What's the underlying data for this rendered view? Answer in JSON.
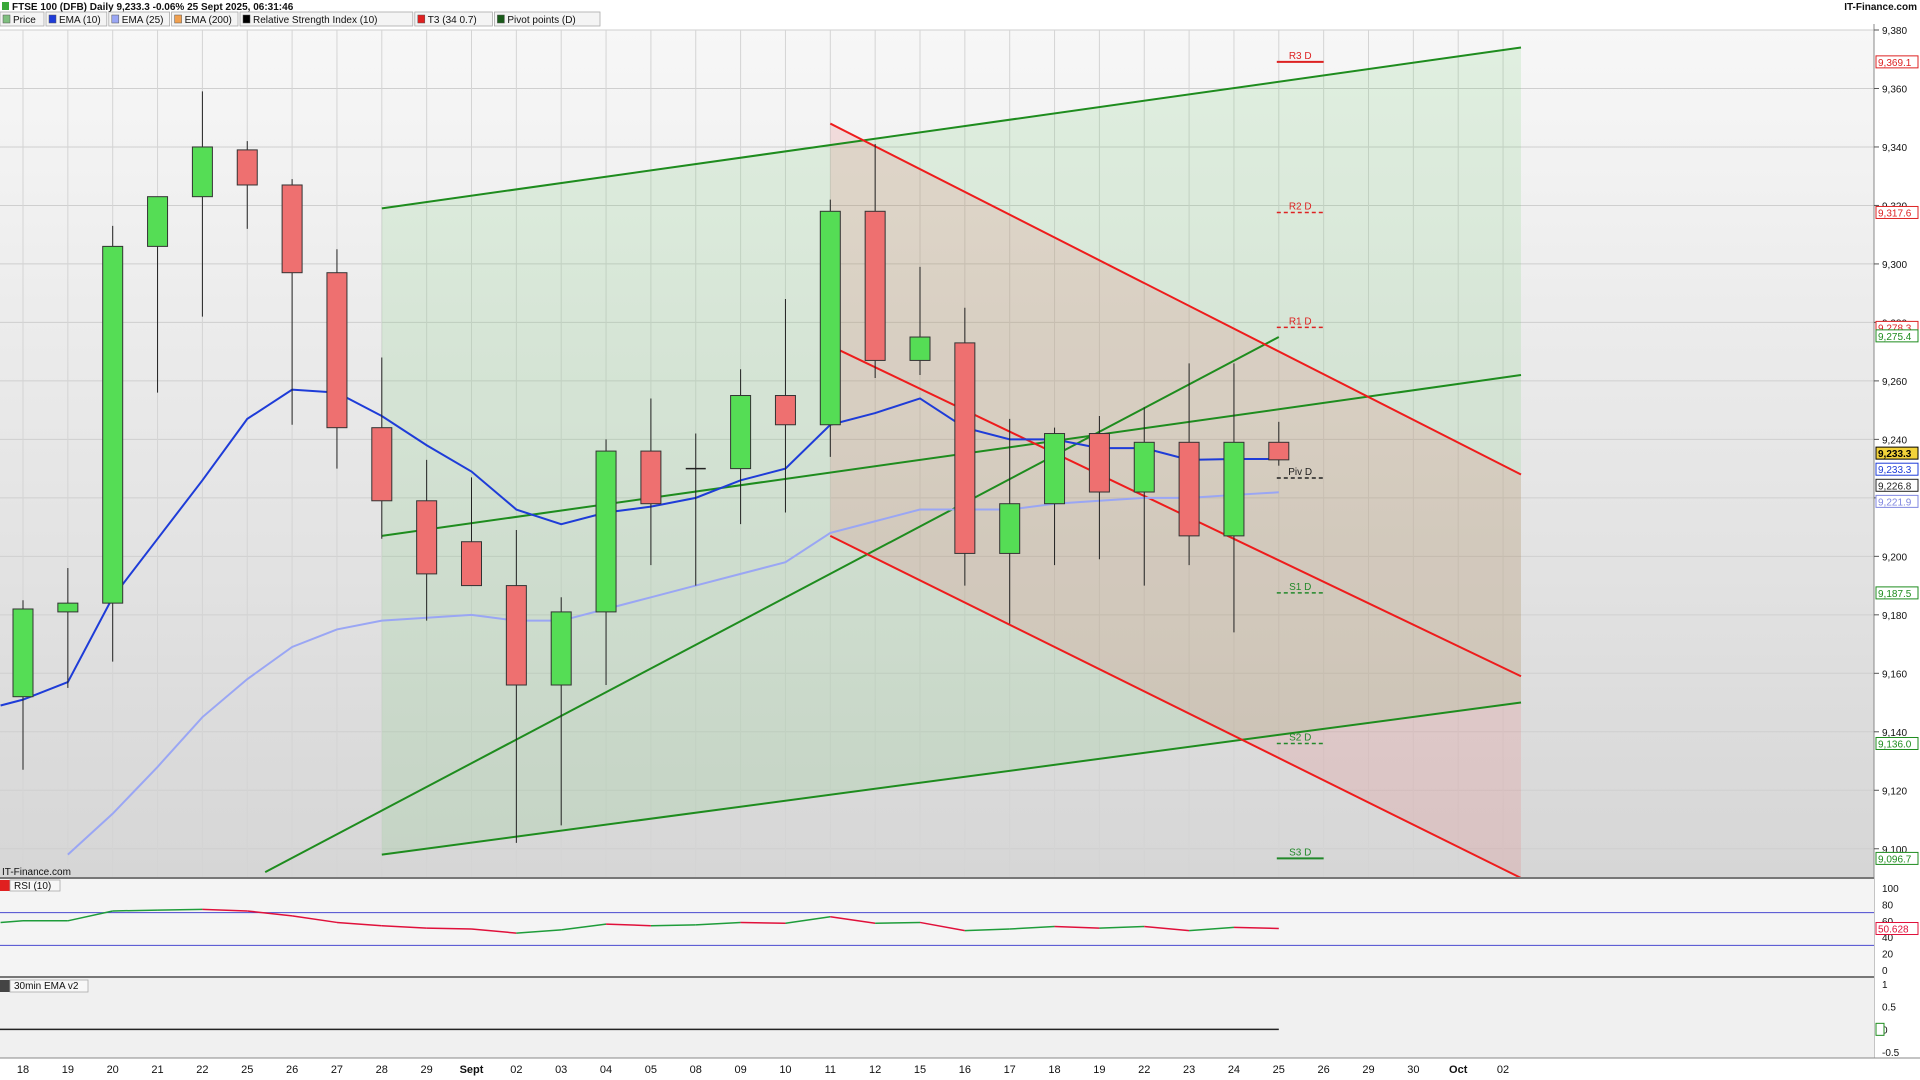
{
  "header": {
    "title": "FTSE 100 (DFB) Daily 9,233.3 -0.06% 25 Sept 2025, 06:31:46",
    "brand": "IT-Finance.com"
  },
  "legend": [
    {
      "label": "Price",
      "color": "#7fbf7f"
    },
    {
      "label": "EMA (10)",
      "color": "#1e3cd8"
    },
    {
      "label": "EMA (25)",
      "color": "#9aa6f4"
    },
    {
      "label": "EMA (200)",
      "color": "#f0a050"
    },
    {
      "label": "Relative Strength Index (10)",
      "color": "#000000"
    },
    {
      "label": "T3 (34 0.7)",
      "color": "#e02020"
    },
    {
      "label": "Pivot points (D)",
      "color": "#1a5a1a"
    }
  ],
  "watermark": "IT-Finance.com",
  "colors": {
    "up": "#55dd55",
    "down": "#ee7070",
    "ema10": "#1e3cd8",
    "ema25": "#9aa6f4",
    "green_channel": "#1e8c1e",
    "red_channel": "#ee1c1c",
    "rsi": "#e0103a"
  },
  "chart_data": {
    "type": "candlestick",
    "y_range": [
      9090,
      9380
    ],
    "y_ticks": [
      {
        "v": 9380,
        "label": "9,380"
      },
      {
        "v": 9360,
        "label": "9,360"
      },
      {
        "v": 9340,
        "label": "9,340"
      },
      {
        "v": 9320,
        "label": "9,320"
      },
      {
        "v": 9300,
        "label": "9,300"
      },
      {
        "v": 9280,
        "label": "9,280"
      },
      {
        "v": 9260,
        "label": "9,260"
      },
      {
        "v": 9240,
        "label": "9,240"
      },
      {
        "v": 9220,
        "label": "9,220"
      },
      {
        "v": 9200,
        "label": "9,200"
      },
      {
        "v": 9180,
        "label": "9,180"
      },
      {
        "v": 9160,
        "label": "9,160"
      },
      {
        "v": 9140,
        "label": "9,140"
      },
      {
        "v": 9120,
        "label": "9,120"
      },
      {
        "v": 9100,
        "label": "9,100"
      }
    ],
    "x_labels": [
      {
        "i": 0,
        "label": "18"
      },
      {
        "i": 1,
        "label": "19"
      },
      {
        "i": 2,
        "label": "20"
      },
      {
        "i": 3,
        "label": "21"
      },
      {
        "i": 4,
        "label": "22"
      },
      {
        "i": 5,
        "label": "25"
      },
      {
        "i": 6,
        "label": "26"
      },
      {
        "i": 7,
        "label": "27"
      },
      {
        "i": 8,
        "label": "28"
      },
      {
        "i": 9,
        "label": "29"
      },
      {
        "i": 10,
        "label": "Sept"
      },
      {
        "i": 11,
        "label": "02"
      },
      {
        "i": 12,
        "label": "03"
      },
      {
        "i": 13,
        "label": "04"
      },
      {
        "i": 14,
        "label": "05"
      },
      {
        "i": 15,
        "label": "08"
      },
      {
        "i": 16,
        "label": "09"
      },
      {
        "i": 17,
        "label": "10"
      },
      {
        "i": 18,
        "label": "11"
      },
      {
        "i": 19,
        "label": "12"
      },
      {
        "i": 20,
        "label": "15"
      },
      {
        "i": 21,
        "label": "16"
      },
      {
        "i": 22,
        "label": "17"
      },
      {
        "i": 23,
        "label": "18"
      },
      {
        "i": 24,
        "label": "19"
      },
      {
        "i": 25,
        "label": "22"
      },
      {
        "i": 26,
        "label": "23"
      },
      {
        "i": 27,
        "label": "24"
      },
      {
        "i": 28,
        "label": "25"
      },
      {
        "i": 29,
        "label": "26"
      },
      {
        "i": 30,
        "label": "29"
      },
      {
        "i": 31,
        "label": "30"
      },
      {
        "i": 32,
        "label": "Oct"
      },
      {
        "i": 33,
        "label": "02"
      }
    ],
    "candles": [
      {
        "i": 0,
        "o": 9152,
        "h": 9185,
        "l": 9127,
        "c": 9182
      },
      {
        "i": 1,
        "o": 9181,
        "h": 9196,
        "l": 9155,
        "c": 9184
      },
      {
        "i": 2,
        "o": 9184,
        "h": 9313,
        "l": 9164,
        "c": 9306
      },
      {
        "i": 3,
        "o": 9306,
        "h": 9320,
        "l": 9256,
        "c": 9323
      },
      {
        "i": 4,
        "o": 9323,
        "h": 9359,
        "l": 9282,
        "c": 9340
      },
      {
        "i": 5,
        "o": 9339,
        "h": 9342,
        "l": 9312,
        "c": 9327
      },
      {
        "i": 6,
        "o": 9327,
        "h": 9329,
        "l": 9245,
        "c": 9297
      },
      {
        "i": 7,
        "o": 9297,
        "h": 9305,
        "l": 9230,
        "c": 9244
      },
      {
        "i": 8,
        "o": 9244,
        "h": 9268,
        "l": 9206,
        "c": 9219
      },
      {
        "i": 9,
        "o": 9219,
        "h": 9233,
        "l": 9178,
        "c": 9194
      },
      {
        "i": 10,
        "o": 9205,
        "h": 9227,
        "l": 9190,
        "c": 9190
      },
      {
        "i": 11,
        "o": 9190,
        "h": 9209,
        "l": 9102,
        "c": 9156
      },
      {
        "i": 12,
        "o": 9156,
        "h": 9186,
        "l": 9108,
        "c": 9181
      },
      {
        "i": 13,
        "o": 9181,
        "h": 9240,
        "l": 9156,
        "c": 9236
      },
      {
        "i": 14,
        "o": 9236,
        "h": 9254,
        "l": 9197,
        "c": 9218
      },
      {
        "i": 15,
        "o": 9230,
        "h": 9242,
        "l": 9190,
        "c": 9230
      },
      {
        "i": 16,
        "o": 9230,
        "h": 9264,
        "l": 9211,
        "c": 9255
      },
      {
        "i": 17,
        "o": 9255,
        "h": 9288,
        "l": 9215,
        "c": 9245
      },
      {
        "i": 18,
        "o": 9245,
        "h": 9322,
        "l": 9234,
        "c": 9318
      },
      {
        "i": 19,
        "o": 9318,
        "h": 9341,
        "l": 9261,
        "c": 9267
      },
      {
        "i": 20,
        "o": 9267,
        "h": 9299,
        "l": 9262,
        "c": 9275
      },
      {
        "i": 21,
        "o": 9273,
        "h": 9285,
        "l": 9190,
        "c": 9201
      },
      {
        "i": 22,
        "o": 9201,
        "h": 9247,
        "l": 9177,
        "c": 9218
      },
      {
        "i": 23,
        "o": 9218,
        "h": 9244,
        "l": 9197,
        "c": 9242
      },
      {
        "i": 24,
        "o": 9242,
        "h": 9248,
        "l": 9199,
        "c": 9222
      },
      {
        "i": 25,
        "o": 9222,
        "h": 9251,
        "l": 9190,
        "c": 9239
      },
      {
        "i": 26,
        "o": 9239,
        "h": 9266,
        "l": 9197,
        "c": 9207
      },
      {
        "i": 27,
        "o": 9207,
        "h": 9266,
        "l": 9174,
        "c": 9239
      },
      {
        "i": 28,
        "o": 9239,
        "h": 9246,
        "l": 9231,
        "c": 9233
      }
    ],
    "ema10": [
      [
        -0.5,
        9149
      ],
      [
        0,
        9151
      ],
      [
        1,
        9157
      ],
      [
        2,
        9186
      ],
      [
        3,
        9206
      ],
      [
        4,
        9226
      ],
      [
        5,
        9247
      ],
      [
        6,
        9257
      ],
      [
        7,
        9256
      ],
      [
        8,
        9248
      ],
      [
        9,
        9238
      ],
      [
        10,
        9229
      ],
      [
        11,
        9216
      ],
      [
        12,
        9211
      ],
      [
        13,
        9215
      ],
      [
        14,
        9217
      ],
      [
        15,
        9220
      ],
      [
        16,
        9226
      ],
      [
        17,
        9230
      ],
      [
        18,
        9245
      ],
      [
        19,
        9249
      ],
      [
        20,
        9254
      ],
      [
        21,
        9244
      ],
      [
        22,
        9240
      ],
      [
        23,
        9240
      ],
      [
        24,
        9237
      ],
      [
        25,
        9237
      ],
      [
        26,
        9233
      ],
      [
        27,
        9233.3
      ],
      [
        28,
        9233.3
      ]
    ],
    "ema25": [
      [
        1,
        9098
      ],
      [
        2,
        9112
      ],
      [
        3,
        9128
      ],
      [
        4,
        9145
      ],
      [
        5,
        9158
      ],
      [
        6,
        9169
      ],
      [
        7,
        9175
      ],
      [
        8,
        9178
      ],
      [
        9,
        9179
      ],
      [
        10,
        9180
      ],
      [
        11,
        9178
      ],
      [
        12,
        9178
      ],
      [
        13,
        9182
      ],
      [
        14,
        9186
      ],
      [
        15,
        9190
      ],
      [
        16,
        9194
      ],
      [
        17,
        9198
      ],
      [
        18,
        9208
      ],
      [
        19,
        9212
      ],
      [
        20,
        9216
      ],
      [
        21,
        9216
      ],
      [
        22,
        9216
      ],
      [
        23,
        9218
      ],
      [
        24,
        9219
      ],
      [
        25,
        9220
      ],
      [
        26,
        9220
      ],
      [
        27,
        9221
      ],
      [
        28,
        9221.9
      ]
    ],
    "green_channel": [
      {
        "from": [
          8,
          9319
        ],
        "to": [
          33.4,
          9374
        ]
      },
      {
        "from": [
          8,
          9098
        ],
        "to": [
          33.4,
          9150
        ]
      },
      {
        "from": [
          8,
          9207
        ],
        "to": [
          33.4,
          9262
        ]
      },
      {
        "from": [
          5.4,
          9092
        ],
        "to": [
          28,
          9275
        ]
      }
    ],
    "red_channel": [
      {
        "from": [
          18,
          9348
        ],
        "to": [
          33.4,
          9228
        ]
      },
      {
        "from": [
          18,
          9272
        ],
        "to": [
          33.4,
          9159
        ]
      },
      {
        "from": [
          18,
          9207
        ],
        "to": [
          33.4,
          9090
        ]
      }
    ],
    "pivots": [
      {
        "label": "R3 D",
        "value": 9369.1,
        "color": "#dd2222",
        "dashed": false
      },
      {
        "label": "R2 D",
        "value": 9317.6,
        "color": "#dd2222",
        "dashed": true
      },
      {
        "label": "R1 D",
        "value": 9278.3,
        "color": "#dd2222",
        "dashed": true
      },
      {
        "label": "Piv D",
        "value": 9226.8,
        "color": "#222222",
        "dashed": true
      },
      {
        "label": "S1 D",
        "value": 9187.5,
        "color": "#22882a",
        "dashed": true
      },
      {
        "label": "S2 D",
        "value": 9136.0,
        "color": "#22882a",
        "dashed": true
      },
      {
        "label": "S3 D",
        "value": 9096.7,
        "color": "#22882a",
        "dashed": false
      }
    ],
    "price_tags": [
      {
        "label": "9,369.1",
        "value": 9369.1,
        "color": "#dd2222",
        "fill": "#ffffff"
      },
      {
        "label": "9,317.6",
        "value": 9317.6,
        "color": "#dd2222",
        "fill": "#ffffff"
      },
      {
        "label": "9,278.3",
        "value": 9278.3,
        "color": "#dd2222",
        "fill": "#ffffff"
      },
      {
        "label": "9,275.4",
        "value": 9275.4,
        "color": "#1e8c1e",
        "fill": "#ffffff"
      },
      {
        "label": "9,233.3",
        "value": 9235.3,
        "color": "#000000",
        "fill": "#f2d23a"
      },
      {
        "label": "9,233.3",
        "value": 9229.8,
        "color": "#1e3cd8",
        "fill": "#ffffff"
      },
      {
        "label": "9,226.8",
        "value": 9224.3,
        "color": "#222222",
        "fill": "#ffffff"
      },
      {
        "label": "9,221.9",
        "value": 9218.8,
        "color": "#7f86e0",
        "fill": "#ffffff"
      },
      {
        "label": "9,187.5",
        "value": 9187.5,
        "color": "#1e8c1e",
        "fill": "#ffffff"
      },
      {
        "label": "9,136.0",
        "value": 9136.0,
        "color": "#1e8c1e",
        "fill": "#ffffff"
      },
      {
        "label": "9,096.7",
        "value": 9096.7,
        "color": "#1e8c1e",
        "fill": "#ffffff"
      }
    ],
    "rsi": {
      "title": "RSI (10)",
      "range": [
        0,
        100
      ],
      "ticks": [
        {
          "v": 100,
          "label": "100"
        },
        {
          "v": 80,
          "label": "80"
        },
        {
          "v": 60,
          "label": "60"
        },
        {
          "v": 40,
          "label": "40"
        },
        {
          "v": 20,
          "label": "20"
        },
        {
          "v": 0,
          "label": "0"
        }
      ],
      "levels": [
        70,
        30
      ],
      "value_label": "50.628",
      "values": [
        [
          -0.5,
          58
        ],
        [
          0,
          60
        ],
        [
          1,
          60
        ],
        [
          2,
          72
        ],
        [
          3,
          73
        ],
        [
          4,
          74
        ],
        [
          5,
          72
        ],
        [
          6,
          66
        ],
        [
          7,
          58
        ],
        [
          8,
          54
        ],
        [
          9,
          51
        ],
        [
          10,
          50
        ],
        [
          11,
          45
        ],
        [
          12,
          49
        ],
        [
          13,
          56
        ],
        [
          14,
          54
        ],
        [
          15,
          55
        ],
        [
          16,
          58
        ],
        [
          17,
          57
        ],
        [
          18,
          65
        ],
        [
          19,
          57
        ],
        [
          20,
          58
        ],
        [
          21,
          48
        ],
        [
          22,
          50
        ],
        [
          23,
          53
        ],
        [
          24,
          51
        ],
        [
          25,
          53
        ],
        [
          26,
          48
        ],
        [
          27,
          52
        ],
        [
          28,
          50.6
        ]
      ]
    },
    "ema30": {
      "title": "30min EMA v2",
      "ticks": [
        {
          "v": 1,
          "label": "1"
        },
        {
          "v": 0.5,
          "label": "0.5"
        },
        {
          "v": 0,
          "label": "0"
        },
        {
          "v": -0.5,
          "label": "-0.5"
        }
      ],
      "range": [
        -0.5,
        1
      ]
    }
  }
}
